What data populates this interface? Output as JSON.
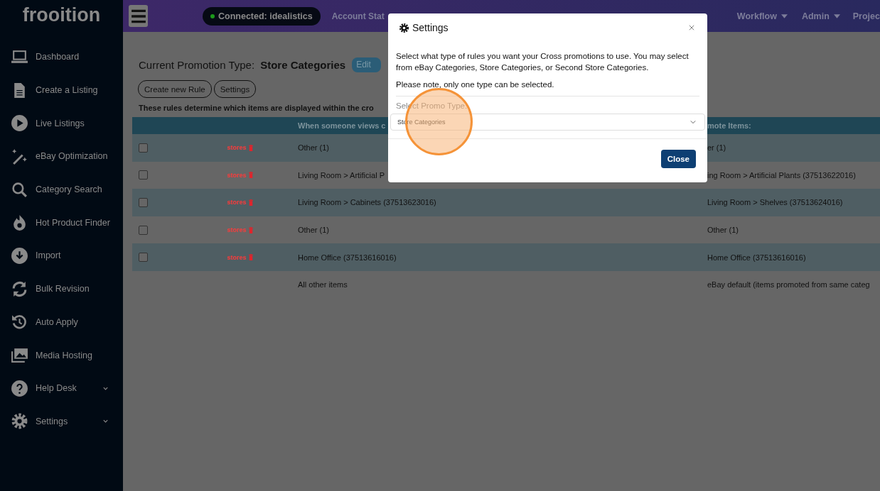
{
  "brand": "frooition",
  "sidebar": {
    "items": [
      {
        "label": "Dashboard",
        "kind": "laptop",
        "expandable": false
      },
      {
        "label": "Create a Listing",
        "kind": "document",
        "expandable": false
      },
      {
        "label": "Live Listings",
        "kind": "play",
        "expandable": false
      },
      {
        "label": "eBay Optimization",
        "kind": "wand",
        "expandable": false
      },
      {
        "label": "Category Search",
        "kind": "search",
        "expandable": false
      },
      {
        "label": "Hot Product Finder",
        "kind": "fire",
        "expandable": false
      },
      {
        "label": "Import",
        "kind": "download",
        "expandable": false
      },
      {
        "label": "Bulk Revision",
        "kind": "refresh",
        "expandable": false
      },
      {
        "label": "Auto Apply",
        "kind": "history",
        "expandable": false
      },
      {
        "label": "Media Hosting",
        "kind": "images",
        "expandable": false
      },
      {
        "label": "Help Desk",
        "kind": "help",
        "expandable": true
      },
      {
        "label": "Settings",
        "kind": "gear",
        "expandable": true
      }
    ]
  },
  "topbar": {
    "connection": "Connected: idealistics",
    "nav": [
      {
        "label": "Account Stat",
        "dropdown": false
      },
      {
        "label": "Workflow",
        "dropdown": true
      },
      {
        "label": "Admin",
        "dropdown": true
      },
      {
        "label": "Projec",
        "dropdown": false
      }
    ]
  },
  "page": {
    "title_label": "Current Promotion Type:",
    "title_value": "Store Categories",
    "edit_button": "Edit",
    "buttons": [
      "Create new Rule",
      "Settings"
    ],
    "note": "These rules determine which items are displayed within the cro"
  },
  "table": {
    "columns": [
      "When someone views c",
      "mote Items:"
    ],
    "rows": [
      {
        "kind": "rule",
        "checked": false,
        "tag": "stores",
        "view": "Other (1)",
        "promote": "er (1)"
      },
      {
        "kind": "rule",
        "checked": false,
        "tag": "stores",
        "view": "Living Room > Artificial P",
        "promote": "ing Room > Artificial Plants (37513622016)"
      },
      {
        "kind": "rule",
        "checked": false,
        "tag": "stores",
        "view": "Living Room > Cabinets (37513623016)",
        "promote": "Living Room > Shelves (37513624016)"
      },
      {
        "kind": "rule",
        "checked": false,
        "tag": "stores",
        "view": "Other (1)",
        "promote": "Other (1)"
      },
      {
        "kind": "rule",
        "checked": false,
        "tag": "stores",
        "view": "Home Office (37513616016)",
        "promote": "Home Office (37513616016)"
      },
      {
        "kind": "default",
        "view": "All other items",
        "promote": "eBay default (items promoted from same categ"
      }
    ]
  },
  "modal": {
    "title": "Settings",
    "intro": "Select what type of rules you want your Cross promotions to use. You may select from eBay Categories, Store Categories, or Second Store Categories.",
    "note": "Please note, only one type can be selected.",
    "field_label": "Select Promo Type:",
    "select_value": "Store Categories",
    "close_button": "Close"
  }
}
